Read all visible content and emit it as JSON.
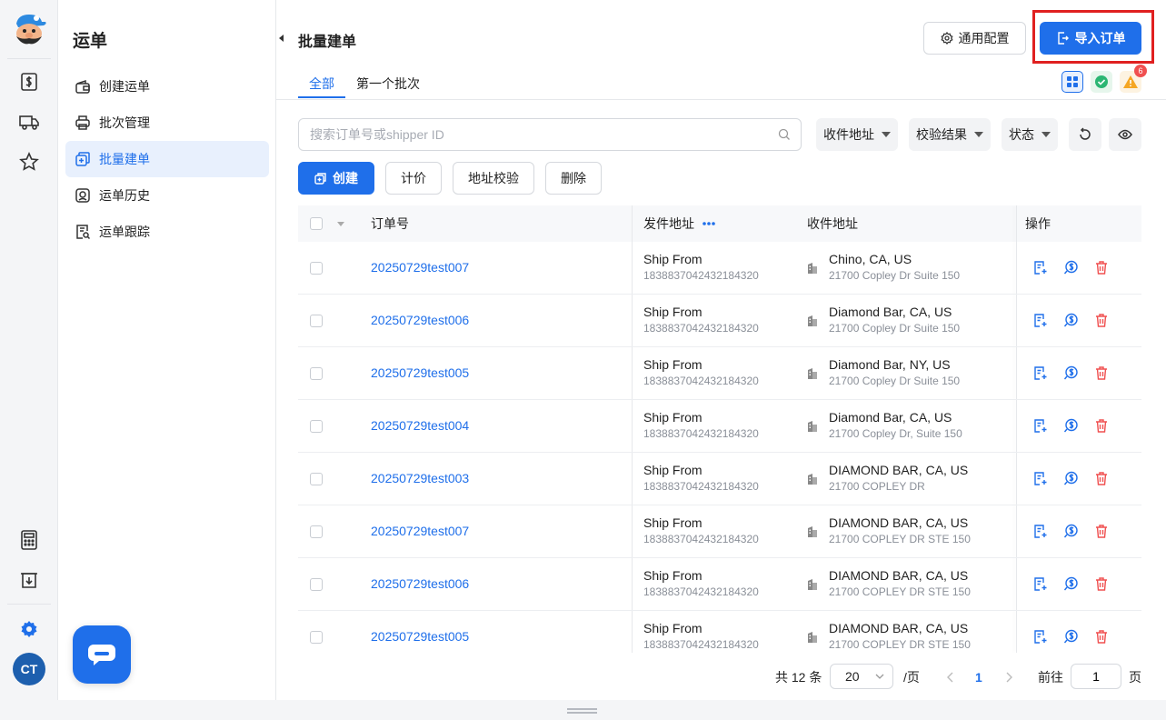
{
  "colors": {
    "primary": "#1f6fea",
    "danger": "#f05050",
    "highlight_border": "#e02020"
  },
  "sidebar": {
    "title": "运单",
    "items": [
      {
        "label": "创建运单",
        "icon": "wallet-box-icon",
        "active": false
      },
      {
        "label": "批次管理",
        "icon": "printer-icon",
        "active": false
      },
      {
        "label": "批量建单",
        "icon": "copy-plus-icon",
        "active": true
      },
      {
        "label": "运单历史",
        "icon": "history-icon",
        "active": false
      },
      {
        "label": "运单跟踪",
        "icon": "track-doc-icon",
        "active": false
      }
    ]
  },
  "rail": {
    "avatar_initials": "CT",
    "icons": [
      "mascot-logo",
      "dollar-doc-icon",
      "truck-icon",
      "star-icon",
      "calculator-icon",
      "download-doc-icon",
      "settings-icon"
    ]
  },
  "header": {
    "title": "批量建单",
    "config_label": "通用配置",
    "import_label": "导入订单"
  },
  "tabs": [
    {
      "label": "全部",
      "active": true
    },
    {
      "label": "第一个批次",
      "active": false
    }
  ],
  "status": {
    "warning_count": "6"
  },
  "search": {
    "placeholder": "搜索订单号或shipper ID",
    "value": ""
  },
  "filters": [
    {
      "label": "收件地址"
    },
    {
      "label": "校验结果"
    },
    {
      "label": "状态"
    }
  ],
  "toolbar": {
    "create_label": "创建",
    "price_label": "计价",
    "validate_label": "地址校验",
    "delete_label": "删除"
  },
  "table": {
    "headers": {
      "order_no": "订单号",
      "from": "发件地址",
      "to": "收件地址",
      "actions": "操作"
    },
    "rows": [
      {
        "order": "20250729test007",
        "from_name": "Ship From",
        "from_id": "1838837042432184320",
        "to_city": "Chino, CA, US",
        "to_street": "21700 Copley Dr Suite 150"
      },
      {
        "order": "20250729test006",
        "from_name": "Ship From",
        "from_id": "1838837042432184320",
        "to_city": "Diamond Bar, CA, US",
        "to_street": "21700 Copley Dr Suite 150"
      },
      {
        "order": "20250729test005",
        "from_name": "Ship From",
        "from_id": "1838837042432184320",
        "to_city": "Diamond Bar, NY, US",
        "to_street": "21700 Copley Dr Suite 150"
      },
      {
        "order": "20250729test004",
        "from_name": "Ship From",
        "from_id": "1838837042432184320",
        "to_city": "Diamond Bar, CA, US",
        "to_street": "21700 Copley Dr, Suite 150"
      },
      {
        "order": "20250729test003",
        "from_name": "Ship From",
        "from_id": "1838837042432184320",
        "to_city": "DIAMOND BAR, CA, US",
        "to_street": "21700 COPLEY DR"
      },
      {
        "order": "20250729test007",
        "from_name": "Ship From",
        "from_id": "1838837042432184320",
        "to_city": "DIAMOND BAR, CA, US",
        "to_street": "21700 COPLEY DR STE 150"
      },
      {
        "order": "20250729test006",
        "from_name": "Ship From",
        "from_id": "1838837042432184320",
        "to_city": "DIAMOND BAR, CA, US",
        "to_street": "21700 COPLEY DR STE 150"
      },
      {
        "order": "20250729test005",
        "from_name": "Ship From",
        "from_id": "1838837042432184320",
        "to_city": "DIAMOND BAR, CA, US",
        "to_street": "21700 COPLEY DR STE 150"
      }
    ]
  },
  "pagination": {
    "total_label": "共 12 条",
    "page_size": "20",
    "per_page_label": "/页",
    "current_page": "1",
    "goto_label": "前往",
    "goto_value": "1",
    "page_suffix": "页"
  }
}
